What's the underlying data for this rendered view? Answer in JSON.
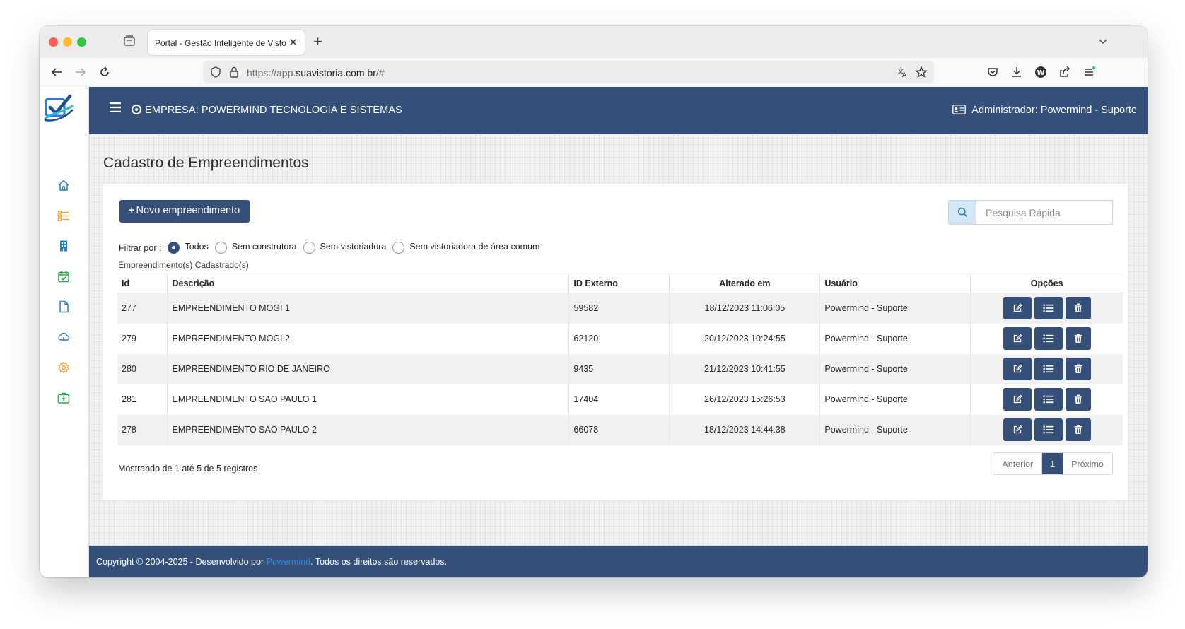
{
  "browser": {
    "tab_title": "Portal - Gestão Inteligente de Vistorias",
    "url_prefix": "https://app.",
    "url_domain": "suavistoria.com.br",
    "url_suffix": "/#"
  },
  "header": {
    "company": "EMPRESA: POWERMIND TECNOLOGIA E SISTEMAS",
    "admin": "Administrador: Powermind - Suporte"
  },
  "page": {
    "title": "Cadastro de Empreendimentos",
    "new_button": "Novo empreendimento",
    "search_placeholder": "Pesquisa Rápida",
    "filter_label": "Filtrar por :",
    "filters": [
      "Todos",
      "Sem construtora",
      "Sem vistoriadora",
      "Sem vistoriadora de área comum"
    ],
    "filter_selected": "Todos",
    "registered_label": "Empreendimento(s) Cadastrado(s)"
  },
  "table": {
    "columns": [
      "Id",
      "Descrição",
      "ID Externo",
      "Alterado em",
      "Usuário",
      "Opções"
    ],
    "rows": [
      {
        "id": "277",
        "descricao": "EMPREENDIMENTO MOGI 1",
        "externo": "59582",
        "alterado": "18/12/2023 11:06:05",
        "usuario": "Powermind - Suporte"
      },
      {
        "id": "279",
        "descricao": "EMPREENDIMENTO MOGI 2",
        "externo": "62120",
        "alterado": "20/12/2023 10:24:55",
        "usuario": "Powermind - Suporte"
      },
      {
        "id": "280",
        "descricao": "EMPREENDIMENTO RIO DE JANEIRO",
        "externo": "9435",
        "alterado": "21/12/2023 10:41:55",
        "usuario": "Powermind - Suporte"
      },
      {
        "id": "281",
        "descricao": "EMPREENDIMENTO SAO PAULO 1",
        "externo": "17404",
        "alterado": "26/12/2023 15:26:53",
        "usuario": "Powermind - Suporte"
      },
      {
        "id": "278",
        "descricao": "EMPREENDIMENTO SAO PAULO 2",
        "externo": "66078",
        "alterado": "18/12/2023 14:44:38",
        "usuario": "Powermind - Suporte"
      }
    ]
  },
  "pagination": {
    "showing": "Mostrando de 1 até 5 de 5 registros",
    "prev": "Anterior",
    "current": "1",
    "next": "Próximo"
  },
  "footer": {
    "before": "Copyright © 2004-2025 - Desenvolvido por ",
    "link": "Powermind",
    "after": ". Todos os direitos são reservados."
  },
  "colors": {
    "primary": "#344f78",
    "link": "#2f8de4",
    "search_button_bg": "#d5e7f7"
  }
}
